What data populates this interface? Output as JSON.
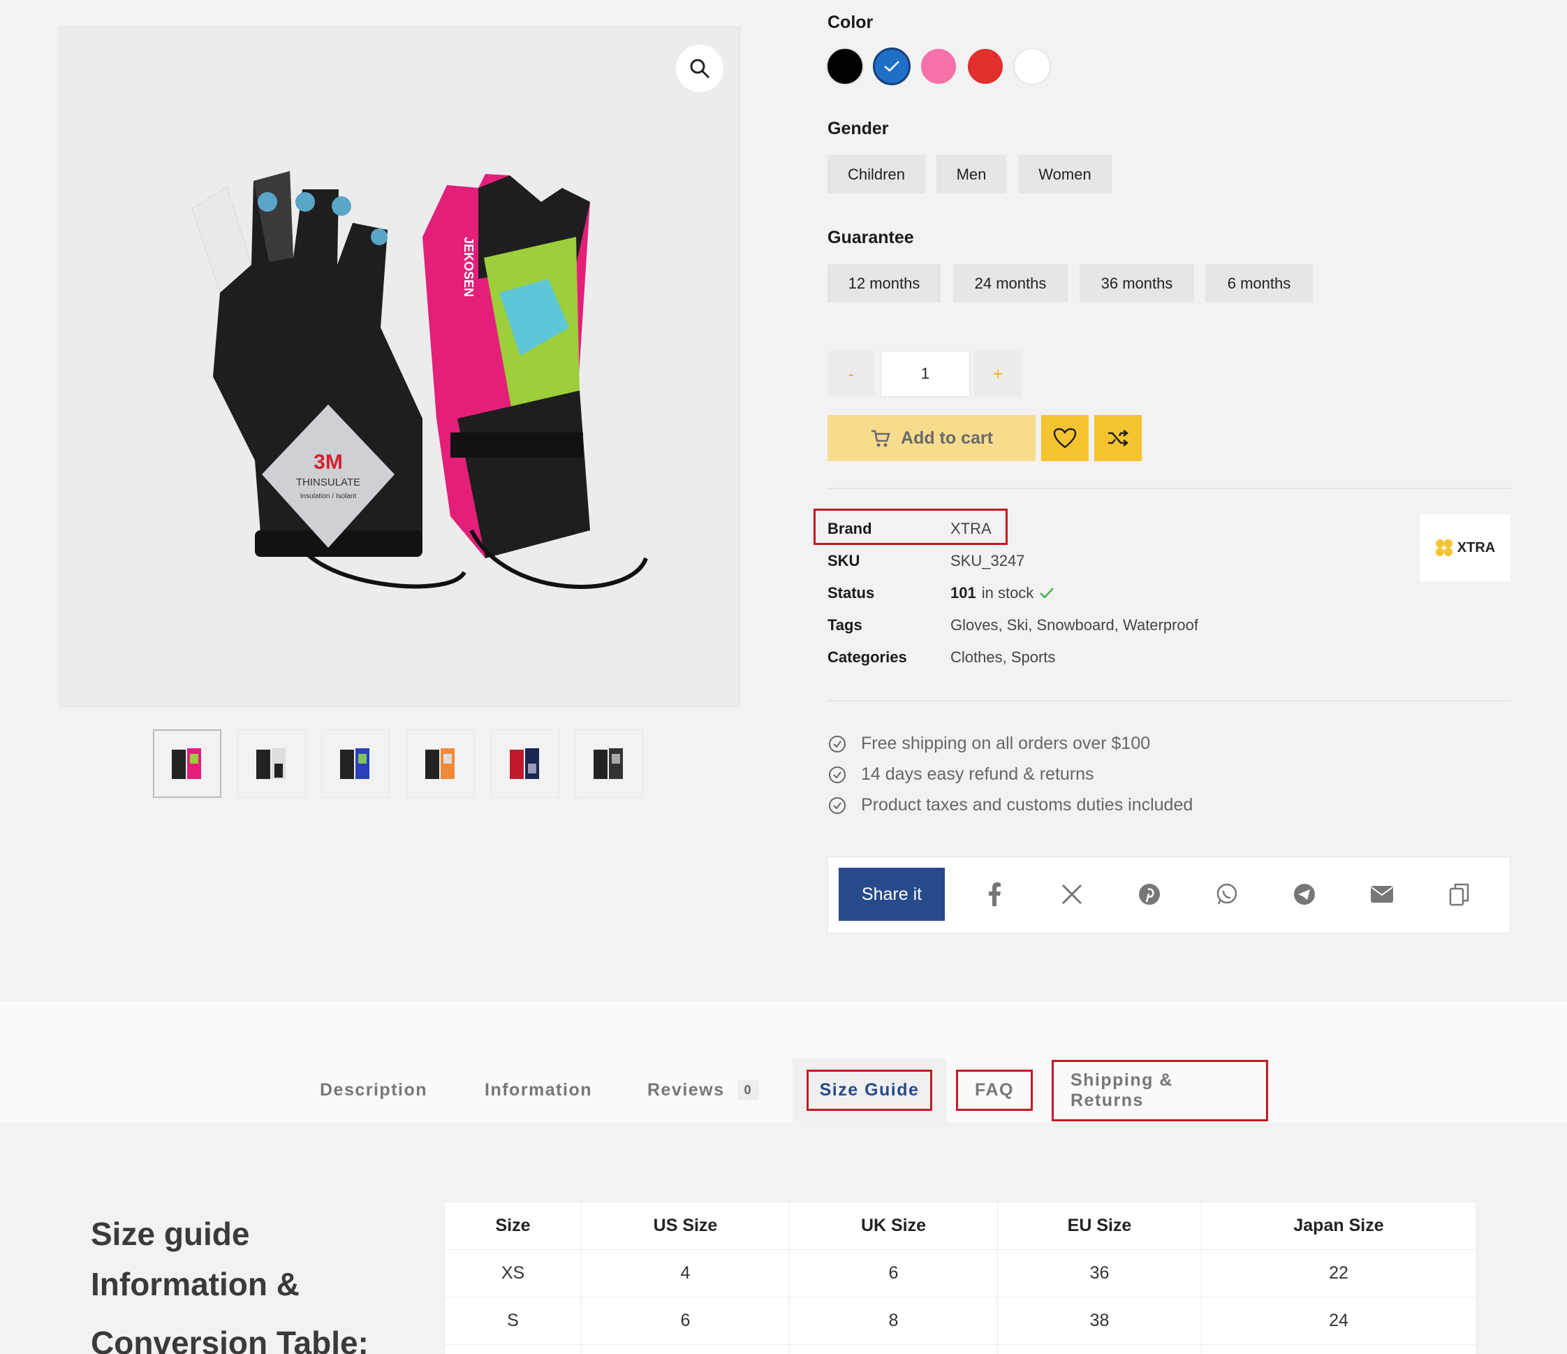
{
  "product": {
    "color_label": "Color",
    "colors": [
      {
        "name": "black",
        "hex": "#000000"
      },
      {
        "name": "blue",
        "hex": "#1f6fc7",
        "selected": true
      },
      {
        "name": "pink",
        "hex": "#f571a7"
      },
      {
        "name": "red",
        "hex": "#e1302e"
      },
      {
        "name": "white",
        "hex": "#ffffff"
      }
    ],
    "gender_label": "Gender",
    "genders": [
      "Children",
      "Men",
      "Women"
    ],
    "guarantee_label": "Guarantee",
    "guarantees": [
      "12 months",
      "24 months",
      "36 months",
      "6 months"
    ],
    "qty_minus": "-",
    "qty_value": "1",
    "qty_plus": "+",
    "add_to_cart": "Add to cart",
    "image_text": {
      "brand_on_glove": "JEKOSEN",
      "tag_brand": "3M",
      "tag_title": "THINSULATE",
      "tag_sub": "Insulation / Isolant"
    },
    "thumbnails": 6
  },
  "meta": {
    "brand_label": "Brand",
    "brand_value": "XTRA",
    "sku_label": "SKU",
    "sku_value": "SKU_3247",
    "status_label": "Status",
    "status_count": "101",
    "status_text": "in stock",
    "tags_label": "Tags",
    "tags_value": "Gloves, Ski, Snowboard, Waterproof",
    "categories_label": "Categories",
    "categories_value": "Clothes, Sports",
    "brand_logo": "XTRA"
  },
  "features": [
    "Free shipping on all orders over $100",
    "14 days easy refund & returns",
    "Product taxes and customs duties included"
  ],
  "share": {
    "label": "Share it",
    "icons": [
      "facebook-icon",
      "x-icon",
      "pinterest-icon",
      "whatsapp-icon",
      "telegram-icon",
      "email-icon",
      "copy-icon"
    ]
  },
  "tabs": {
    "description": "Description",
    "information": "Information",
    "reviews": "Reviews",
    "reviews_count": "0",
    "size_guide": "Size Guide",
    "faq": "FAQ",
    "shipping": "Shipping & Returns"
  },
  "size_guide": {
    "title_line1": "Size guide",
    "title_line2": "Information &",
    "title_line3": "Conversion Table:",
    "headers": [
      "Size",
      "US Size",
      "UK Size",
      "EU Size",
      "Japan Size"
    ],
    "rows": [
      [
        "XS",
        "4",
        "6",
        "36",
        "22"
      ],
      [
        "S",
        "6",
        "8",
        "38",
        "24"
      ]
    ]
  },
  "colors": {
    "accent_yellow": "#f6c430",
    "cart_bg": "#f7dc8e",
    "navy": "#274a8a",
    "highlight_red": "#c01a22",
    "check_green": "#4caf50"
  }
}
